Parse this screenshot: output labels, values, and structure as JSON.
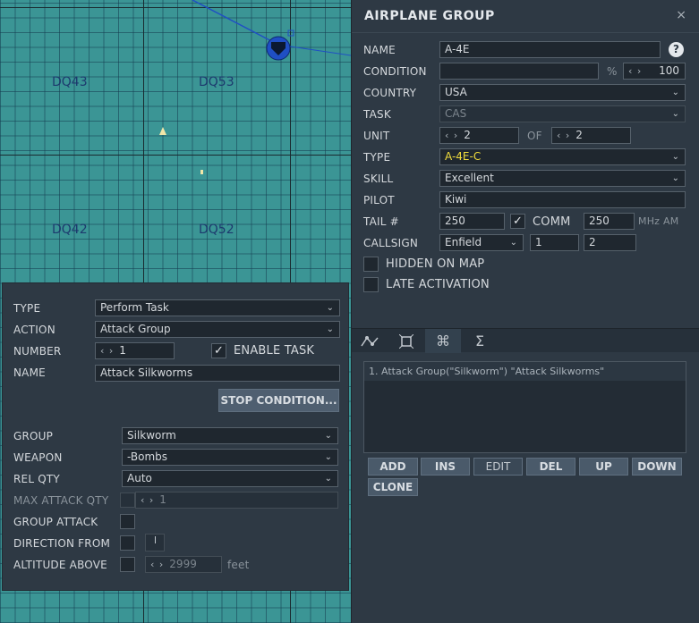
{
  "map": {
    "grid_labels": [
      "DQ43",
      "DQ53",
      "DQ42",
      "DQ52"
    ]
  },
  "task_panel": {
    "type_label": "TYPE",
    "type_value": "Perform Task",
    "action_label": "ACTION",
    "action_value": "Attack Group",
    "number_label": "NUMBER",
    "number_value": "1",
    "enable_task_label": "ENABLE TASK",
    "name_label": "NAME",
    "name_value": "Attack Silkworms",
    "stop_condition_label": "STOP CONDITION...",
    "group_label": "GROUP",
    "group_value": "Silkworm",
    "weapon_label": "WEAPON",
    "weapon_value": "-Bombs",
    "rel_qty_label": "REL QTY",
    "rel_qty_value": "Auto",
    "max_attack_qty_label": "MAX ATTACK QTY",
    "max_attack_qty_value": "1",
    "group_attack_label": "GROUP ATTACK",
    "direction_from_label": "DIRECTION FROM",
    "altitude_above_label": "ALTITUDE ABOVE",
    "altitude_value": "2999",
    "altitude_unit": "feet"
  },
  "right_panel": {
    "title": "AIRPLANE GROUP",
    "close_glyph": "×",
    "help_glyph": "?",
    "name_label": "NAME",
    "name_value": "A-4E",
    "condition_label": "CONDITION",
    "condition_value": "",
    "condition_unit": "%",
    "condition_pct": "100",
    "country_label": "COUNTRY",
    "country_value": "USA",
    "task_label": "TASK",
    "task_value": "CAS",
    "unit_label": "UNIT",
    "unit_value": "2",
    "unit_of": "OF",
    "unit_total": "2",
    "type_label": "TYPE",
    "type_value": "A-4E-C",
    "skill_label": "SKILL",
    "skill_value": "Excellent",
    "pilot_label": "PILOT",
    "pilot_value": "Kiwi",
    "tail_label": "TAIL #",
    "tail_value": "250",
    "comm_label": "COMM",
    "comm_value": "250",
    "comm_unit": "MHz",
    "comm_mode": "AM",
    "callsign_label": "CALLSIGN",
    "callsign_value": "Enfield",
    "callsign_num1": "1",
    "callsign_num2": "2",
    "hidden_on_map_label": "HIDDEN ON MAP",
    "late_activation_label": "LATE ACTIVATION",
    "task_list": [
      "1. Attack Group(\"Silkworm\") \"Attack Silkworms\""
    ],
    "buttons": {
      "add": "ADD",
      "ins": "INS",
      "edit": "EDIT",
      "del": "DEL",
      "up": "UP",
      "down": "DOWN",
      "clone": "CLONE"
    }
  },
  "colors": {
    "accent_type": "#f0dc3c",
    "map_water": "#3b9595",
    "panel": "#2e3944"
  },
  "icons": [
    "route-icon",
    "payload-icon",
    "actions-icon",
    "summary-icon",
    "checkmark-icon",
    "chevron-down-icon",
    "close-icon",
    "help-icon"
  ]
}
